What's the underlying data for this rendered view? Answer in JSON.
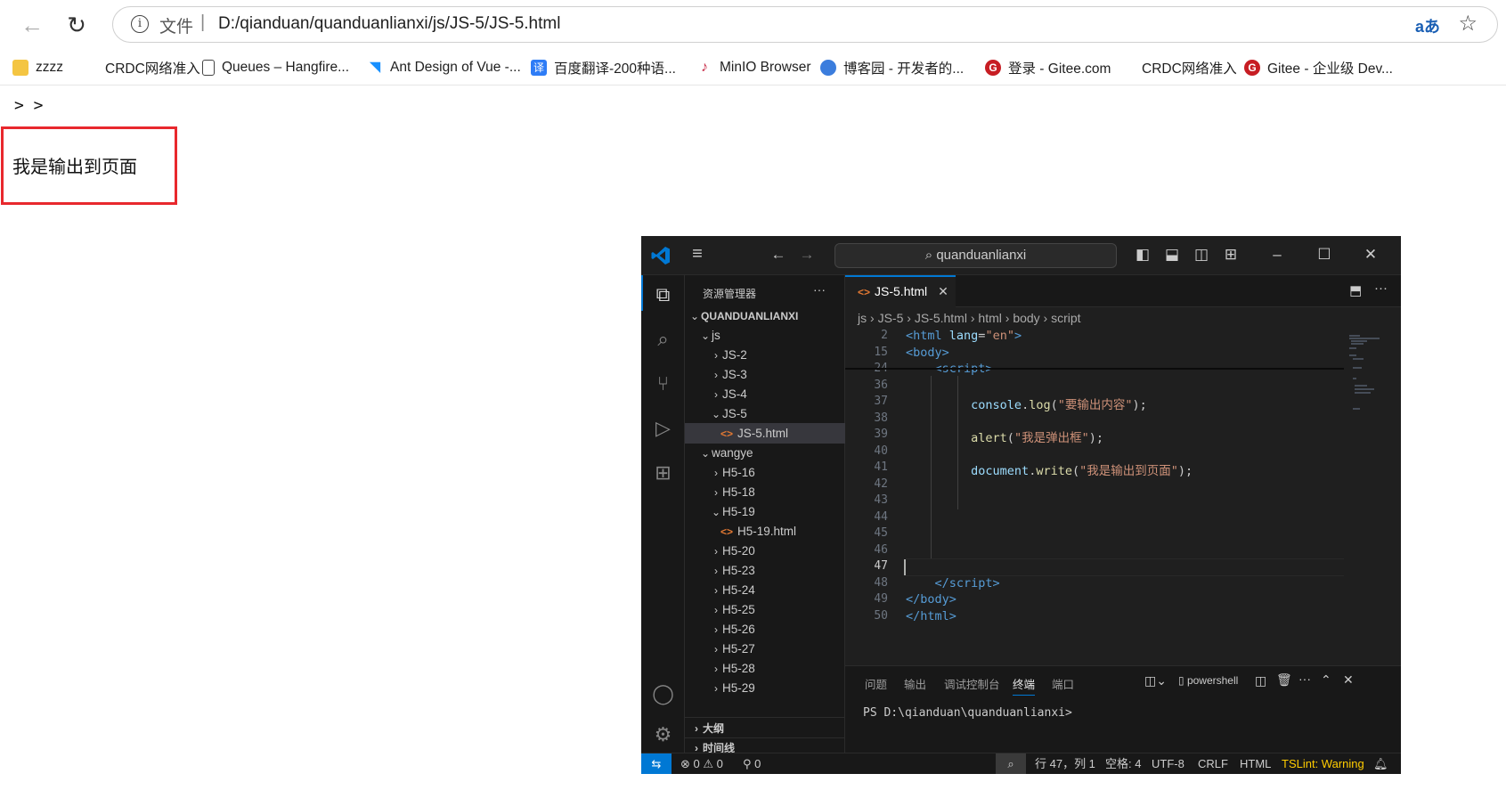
{
  "browser": {
    "file_label": "文件",
    "separator": "|",
    "url": "D:/qianduan/quanduanlianxi/js/JS-5/JS-5.html",
    "read_aloud": "aあ",
    "bookmarks": [
      "zzzz",
      "CRDC网络准入",
      "Queues – Hangfire...",
      "Ant Design of Vue -...",
      "百度翻译-200种语...",
      "MinIO Browser",
      "博客园 - 开发者的...",
      "登录 - Gitee.com",
      "CRDC网络准入",
      "Gitee - 企业级 Dev..."
    ]
  },
  "page": {
    "top_text": "> >",
    "output_text": "我是输出到页面"
  },
  "vscode": {
    "search": "quanduanlianxi",
    "explorer_title": "资源管理器",
    "more": "···",
    "tree": [
      {
        "label": "QUANDUANLIANXI",
        "indent": 1,
        "chev": "⌄",
        "bold": true
      },
      {
        "label": "js",
        "indent": 2,
        "chev": "⌄"
      },
      {
        "label": "JS-2",
        "indent": 3,
        "chev": "›"
      },
      {
        "label": "JS-3",
        "indent": 3,
        "chev": "›"
      },
      {
        "label": "JS-4",
        "indent": 3,
        "chev": "›"
      },
      {
        "label": "JS-5",
        "indent": 3,
        "chev": "⌄"
      },
      {
        "label": "JS-5.html",
        "indent": 4,
        "chev": "",
        "file": true,
        "selected": true
      },
      {
        "label": "wangye",
        "indent": 2,
        "chev": "⌄"
      },
      {
        "label": "H5-16",
        "indent": 3,
        "chev": "›"
      },
      {
        "label": "H5-18",
        "indent": 3,
        "chev": "›"
      },
      {
        "label": "H5-19",
        "indent": 3,
        "chev": "⌄"
      },
      {
        "label": "H5-19.html",
        "indent": 4,
        "chev": "",
        "file": true
      },
      {
        "label": "H5-20",
        "indent": 3,
        "chev": "›"
      },
      {
        "label": "H5-23",
        "indent": 3,
        "chev": "›"
      },
      {
        "label": "H5-24",
        "indent": 3,
        "chev": "›"
      },
      {
        "label": "H5-25",
        "indent": 3,
        "chev": "›"
      },
      {
        "label": "H5-26",
        "indent": 3,
        "chev": "›"
      },
      {
        "label": "H5-27",
        "indent": 3,
        "chev": "›"
      },
      {
        "label": "H5-28",
        "indent": 3,
        "chev": "›"
      },
      {
        "label": "H5-29",
        "indent": 3,
        "chev": "›"
      }
    ],
    "outline": "大纲",
    "timeline": "时间线",
    "tab": "JS-5.html",
    "breadcrumb": [
      "js",
      "JS-5",
      "JS-5.html",
      "html",
      "body",
      "script"
    ],
    "lines": [
      {
        "n": "2",
        "html": "<span class=\"tag\">&lt;html</span> <span class=\"attr\">lang</span>=<span class=\"str\">\"en\"</span><span class=\"tag\">&gt;</span>"
      },
      {
        "n": "15",
        "html": "<span class=\"tag\">&lt;body&gt;</span>"
      },
      {
        "n": "24",
        "html": "    <span class=\"tag\">&lt;script&gt;</span>"
      },
      {
        "n": "36",
        "html": ""
      },
      {
        "n": "37",
        "html": "         <span class=\"var\">console</span>.<span class=\"fn\">log</span>(<span class=\"str\">\"要输出内容\"</span>);"
      },
      {
        "n": "38",
        "html": ""
      },
      {
        "n": "39",
        "html": "         <span class=\"fn\">alert</span>(<span class=\"str\">\"我是弹出框\"</span>);"
      },
      {
        "n": "40",
        "html": ""
      },
      {
        "n": "41",
        "html": "         <span class=\"var\">document</span>.<span class=\"fn\">write</span>(<span class=\"str\">\"我是输出到页面\"</span>);"
      },
      {
        "n": "42",
        "html": ""
      },
      {
        "n": "43",
        "html": ""
      },
      {
        "n": "44",
        "html": ""
      },
      {
        "n": "45",
        "html": ""
      },
      {
        "n": "46",
        "html": ""
      },
      {
        "n": "47",
        "html": ""
      },
      {
        "n": "48",
        "html": "    <span class=\"tag\">&lt;/script&gt;</span>"
      },
      {
        "n": "49",
        "html": "<span class=\"tag\">&lt;/body&gt;</span>"
      },
      {
        "n": "50",
        "html": "<span class=\"tag\">&lt;/html&gt;</span>"
      }
    ],
    "panel_tabs": [
      "问题",
      "输出",
      "调试控制台",
      "终端",
      "端口"
    ],
    "active_panel_tab": "终端",
    "terminal_name": "powershell",
    "terminal_prompt": "PS D:\\qianduan\\quanduanlianxi>",
    "status": {
      "errors": "0",
      "warnings": "0",
      "ports": "0",
      "position": "行 47，列 1",
      "spaces": "空格: 4",
      "encoding": "UTF-8",
      "eol": "CRLF",
      "language": "HTML",
      "lint": "TSLint: Warning"
    },
    "colors": {
      "accent": "#0078d4",
      "highlight": "#e8282d",
      "lint_warning": "#ffcc00"
    }
  }
}
